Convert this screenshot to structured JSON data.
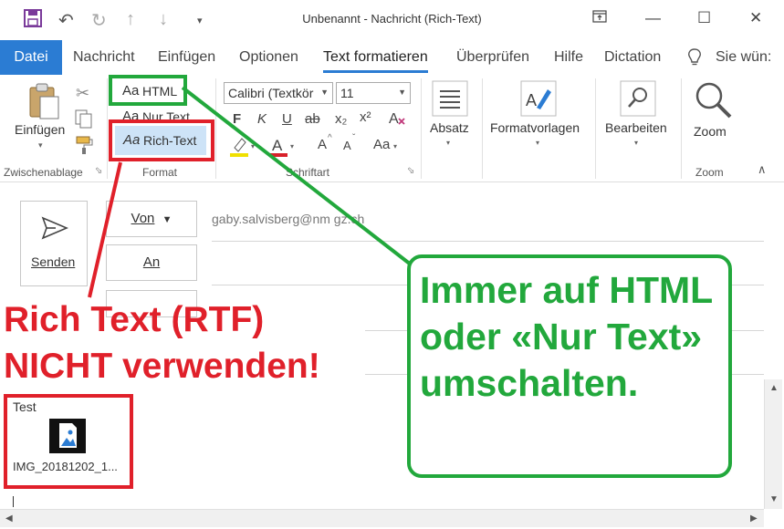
{
  "window": {
    "title": "Unbenannt  -  Nachricht (Rich-Text)"
  },
  "tabs": [
    "Datei",
    "Nachricht",
    "Einfügen",
    "Optionen",
    "Text formatieren",
    "Überprüfen",
    "Hilfe",
    "Dictation",
    "Sie wün:"
  ],
  "active_tab": "Text formatieren",
  "ribbon": {
    "clipboard": {
      "paste_label": "Einfügen",
      "group_label": "Zwischenablage"
    },
    "format": {
      "html": "HTML",
      "plain": "Nur Text",
      "rich": "Rich-Text",
      "prefix": "Aa",
      "group_label": "Format"
    },
    "font": {
      "font_name": "Calibri (Textkör",
      "font_size": "11",
      "group_label": "Schriftart",
      "bold": "F",
      "italic": "K",
      "underline": "U",
      "strike": "ab",
      "sub": "x₂",
      "sup": "x²",
      "grow": "A",
      "shrink": "A",
      "case": "Aa"
    },
    "absatz_label": "Absatz",
    "styles_label": "Formatvorlagen",
    "edit_label": "Bearbeiten",
    "zoom_label": "Zoom",
    "zoom_group_label": "Zoom"
  },
  "message": {
    "send_label": "Senden",
    "from_label": "Von",
    "from_value": "gaby.salvisberg@nm gz.ch",
    "to_label": "An"
  },
  "attachment": {
    "heading": "Test",
    "filename": "IMG_20181202_1..."
  },
  "annotations": {
    "red_line1": "Rich Text (RTF)",
    "red_line2": "NICHT verwenden!",
    "green_line1": "Immer auf HTML",
    "green_line2": "oder «Nur Text»",
    "green_line3": "umschalten.",
    "red_color": "#e0202a",
    "green_color": "#22a83c"
  },
  "colors": {
    "accent": "#2b7cd3"
  }
}
